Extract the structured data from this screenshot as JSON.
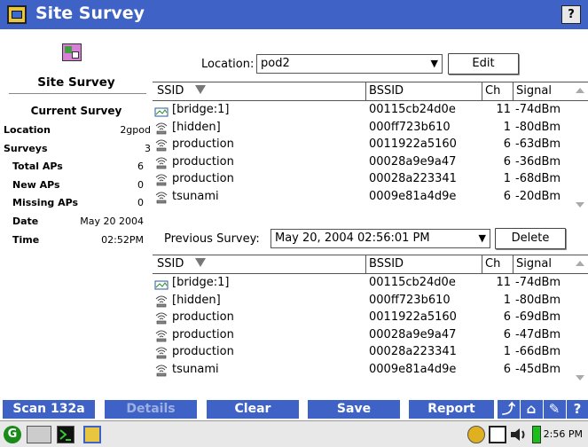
{
  "window": {
    "title": "Site Survey",
    "help_label": "?"
  },
  "left": {
    "heading": "Site Survey",
    "current_survey_label": "Current Survey",
    "info": [
      {
        "key": "Location",
        "value": "2gpod"
      },
      {
        "key": "Surveys",
        "value": "3"
      },
      {
        "key": "Total APs",
        "value": "6"
      },
      {
        "key": "New APs",
        "value": "0"
      },
      {
        "key": "Missing APs",
        "value": "0"
      },
      {
        "key": "Date",
        "value": "May 20 2004"
      },
      {
        "key": "Time",
        "value": "02:52PM"
      }
    ]
  },
  "location": {
    "label": "Location:",
    "value": "pod2",
    "edit_label": "Edit"
  },
  "columns": {
    "ssid": "SSID",
    "bssid": "BSSID",
    "ch": "Ch",
    "signal": "Signal"
  },
  "current_table": [
    {
      "icon": "bridge-icon",
      "ssid": "[bridge:1]",
      "bssid": "00115cb24d0e",
      "ch": "11",
      "signal": "-74dBm"
    },
    {
      "icon": "access-point-icon",
      "ssid": "[hidden]",
      "bssid": "000ff723b610",
      "ch": "1",
      "signal": "-80dBm"
    },
    {
      "icon": "access-point-icon",
      "ssid": "production",
      "bssid": "0011922a5160",
      "ch": "6",
      "signal": "-63dBm"
    },
    {
      "icon": "access-point-icon",
      "ssid": "production",
      "bssid": "00028a9e9a47",
      "ch": "6",
      "signal": "-36dBm"
    },
    {
      "icon": "access-point-icon",
      "ssid": "production",
      "bssid": "00028a223341",
      "ch": "1",
      "signal": "-68dBm"
    },
    {
      "icon": "access-point-icon",
      "ssid": "tsunami",
      "bssid": "0009e81a4d9e",
      "ch": "6",
      "signal": "-20dBm"
    }
  ],
  "previous": {
    "label": "Previous Survey:",
    "value": "May 20, 2004  02:56:01 PM",
    "delete_label": "Delete"
  },
  "previous_table": [
    {
      "icon": "bridge-icon",
      "ssid": "[bridge:1]",
      "bssid": "00115cb24d0e",
      "ch": "11",
      "signal": "-74dBm"
    },
    {
      "icon": "access-point-icon",
      "ssid": "[hidden]",
      "bssid": "000ff723b610",
      "ch": "1",
      "signal": "-80dBm"
    },
    {
      "icon": "access-point-icon",
      "ssid": "production",
      "bssid": "0011922a5160",
      "ch": "6",
      "signal": "-69dBm"
    },
    {
      "icon": "access-point-icon",
      "ssid": "production",
      "bssid": "00028a9e9a47",
      "ch": "6",
      "signal": "-47dBm"
    },
    {
      "icon": "access-point-icon",
      "ssid": "production",
      "bssid": "00028a223341",
      "ch": "1",
      "signal": "-66dBm"
    },
    {
      "icon": "access-point-icon",
      "ssid": "tsunami",
      "bssid": "0009e81a4d9e",
      "ch": "6",
      "signal": "-45dBm"
    }
  ],
  "toolbar": {
    "scan_label": "Scan 132a",
    "details_label": "Details",
    "clear_label": "Clear",
    "save_label": "Save",
    "report_label": "Report"
  },
  "taskbar": {
    "clock": "2:56 PM"
  },
  "colors": {
    "accent": "#3e62c6",
    "titlebar_text": "#ffffff"
  }
}
